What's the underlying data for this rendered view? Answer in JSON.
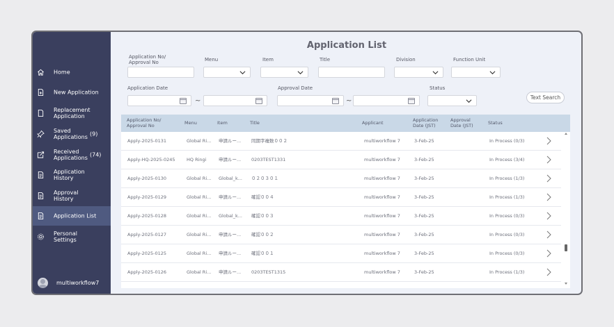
{
  "app": {
    "title": "Application List"
  },
  "sidebar": {
    "items": [
      {
        "label": "Home",
        "icon": "home-icon"
      },
      {
        "label": "New Application",
        "icon": "new-doc-icon"
      },
      {
        "label": "Replacement Application",
        "icon": "doc-icon"
      },
      {
        "label": "Saved Applications",
        "count": "(9)",
        "icon": "pin-icon"
      },
      {
        "label": "Received Applications",
        "count": "(74)",
        "icon": "inbox-icon"
      },
      {
        "label": "Application History",
        "icon": "history-doc-icon"
      },
      {
        "label": "Approval History",
        "icon": "approval-doc-icon"
      },
      {
        "label": "Application List",
        "icon": "list-doc-icon",
        "active": true
      },
      {
        "label": "Personal Settings",
        "icon": "gear-icon"
      }
    ],
    "user": {
      "name": "multiworkflow7"
    }
  },
  "filters": {
    "app_no_label": "Application No/ Approval No",
    "menu_label": "Menu",
    "item_label": "Item",
    "title_label": "Title",
    "division_label": "Division",
    "function_unit_label": "Function Unit",
    "application_date_label": "Application Date",
    "approval_date_label": "Approval Date",
    "status_label": "Status",
    "tilde": "~",
    "text_search": "Text Search"
  },
  "table": {
    "headers": {
      "app_no": "Application No/ Approval No",
      "menu": "Menu",
      "item": "Item",
      "title": "Title",
      "applicant": "Applicant",
      "app_date": "Application Date (JST)",
      "appr_date": "Approval Date (JST)",
      "status": "Status"
    },
    "rows": [
      {
        "app_no": "Apply-2025-0131",
        "menu": "Global Ri...",
        "item": "申請ルー...",
        "title": "同期字複数００２",
        "applicant": "multiworkflow 7",
        "app_date": "3-Feb-25",
        "status": "In Process (0/3)"
      },
      {
        "app_no": "Apply-HQ-2025-0245",
        "menu": "HQ Ringi",
        "item": "申請ルー...",
        "title": "0203TEST1331",
        "applicant": "multiworkflow 7",
        "app_date": "3-Feb-25",
        "status": "In Process (3/4)"
      },
      {
        "app_no": "Apply-2025-0130",
        "menu": "Global Ri...",
        "item": "Global_k...",
        "title": "０２０３０１",
        "applicant": "multiworkflow 7",
        "app_date": "3-Feb-25",
        "status": "In Process (1/3)"
      },
      {
        "app_no": "Apply-2025-0129",
        "menu": "Global Ri...",
        "item": "申請ルー...",
        "title": "確認００４",
        "applicant": "multiworkflow 7",
        "app_date": "3-Feb-25",
        "status": "In Process (1/3)"
      },
      {
        "app_no": "Apply-2025-0128",
        "menu": "Global Ri...",
        "item": "Global_k...",
        "title": "確認００３",
        "applicant": "multiworkflow 7",
        "app_date": "3-Feb-25",
        "status": "In Process (0/3)"
      },
      {
        "app_no": "Apply-2025-0127",
        "menu": "Global Ri...",
        "item": "申請ルー...",
        "title": "確認００２",
        "applicant": "multiworkflow 7",
        "app_date": "3-Feb-25",
        "status": "In Process (0/3)"
      },
      {
        "app_no": "Apply-2025-0125",
        "menu": "Global Ri...",
        "item": "申請ルー...",
        "title": "確認００１",
        "applicant": "multiworkflow 7",
        "app_date": "3-Feb-25",
        "status": "In Process (0/3)"
      },
      {
        "app_no": "Apply-2025-0126",
        "menu": "Global Ri...",
        "item": "申請ルー...",
        "title": "0203TEST1315",
        "applicant": "multiworkflow 7",
        "app_date": "3-Feb-25",
        "status": "In Process (1/3)"
      }
    ]
  },
  "colors": {
    "sidebar_bg": "#3a3f5e",
    "sidebar_active": "#4f5a80",
    "table_header_bg": "#c9d8e7"
  }
}
